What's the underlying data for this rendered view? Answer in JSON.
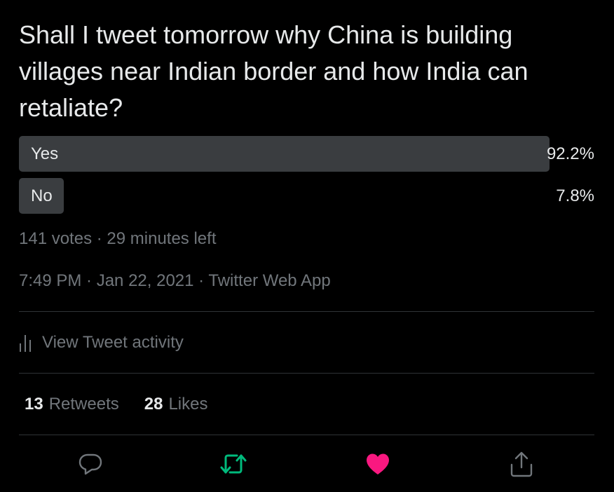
{
  "tweet": {
    "text": "Shall I tweet tomorrow why China is building villages near Indian border and how India can retaliate?"
  },
  "poll": {
    "options": [
      {
        "label": "Yes",
        "percent_text": "92.2%",
        "percent": 92.2,
        "leading": true
      },
      {
        "label": "No",
        "percent_text": "7.8%",
        "percent": 7.8,
        "leading": false
      }
    ],
    "summary": "141 votes · 29 minutes left"
  },
  "meta": {
    "timestamp": "7:49 PM · Jan 22, 2021 · Twitter Web App"
  },
  "activity": {
    "label": "View Tweet activity"
  },
  "stats": {
    "retweets_count": "13",
    "retweets_label": "Retweets",
    "likes_count": "28",
    "likes_label": "Likes"
  },
  "actions": {
    "reply_icon": "reply-icon",
    "retweet_icon": "retweet-icon",
    "like_icon": "heart-icon",
    "share_icon": "share-icon"
  },
  "colors": {
    "background": "#000000",
    "text": "#e7e9ea",
    "secondary": "#71767b",
    "poll_bar": "#3a3d40",
    "retweet_active": "#00ba7c",
    "like_active": "#f91880",
    "divider": "#2f3336"
  }
}
